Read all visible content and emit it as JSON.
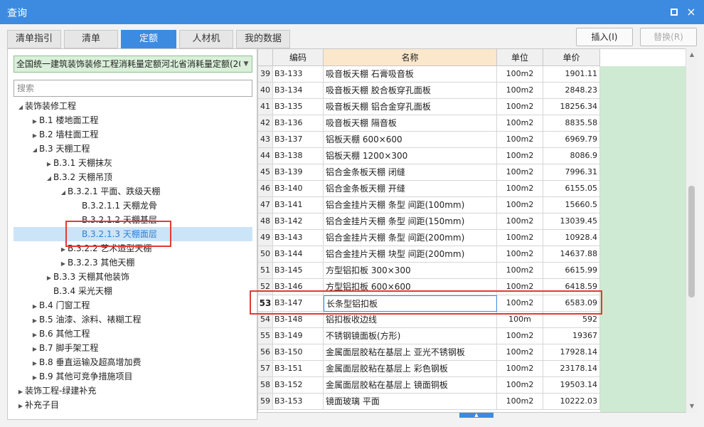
{
  "window": {
    "title": "查询",
    "maximize_label": "",
    "close_label": "×"
  },
  "tabs": [
    {
      "label": "清单指引",
      "active": false
    },
    {
      "label": "清单",
      "active": false
    },
    {
      "label": "定额",
      "active": true
    },
    {
      "label": "人材机",
      "active": false
    },
    {
      "label": "我的数据",
      "active": false
    }
  ],
  "actions": {
    "insert": "插入(I)",
    "replace": "替换(R)"
  },
  "library": {
    "selected": "全国统一建筑装饰装修工程消耗量定额河北省消耗量定额(20"
  },
  "search": {
    "placeholder": "搜索"
  },
  "tree": [
    {
      "label": "装饰装修工程",
      "expanded": true
    },
    {
      "label": "B.1 楼地面工程",
      "expanded": false
    },
    {
      "label": "B.2 墙柱面工程",
      "expanded": false
    },
    {
      "label": "B.3 天棚工程",
      "expanded": true
    },
    {
      "label": "B.3.1 天棚抹灰",
      "expanded": false
    },
    {
      "label": "B.3.2 天棚吊顶",
      "expanded": true
    },
    {
      "label": "B.3.2.1 平面、跌级天棚",
      "expanded": true
    },
    {
      "label": "B.3.2.1.1 天棚龙骨",
      "expanded": null
    },
    {
      "label": "B.3.2.1.2 天棚基层",
      "expanded": null
    },
    {
      "label": "B.3.2.1.3 天棚面层",
      "expanded": null,
      "selected": true
    },
    {
      "label": "B.3.2.2 艺术造型天棚",
      "expanded": false
    },
    {
      "label": "B.3.2.3 其他天棚",
      "expanded": false
    },
    {
      "label": "B.3.3 天棚其他装饰",
      "expanded": false
    },
    {
      "label": "B.3.4 采光天棚",
      "expanded": null
    },
    {
      "label": "B.4 门窗工程",
      "expanded": false
    },
    {
      "label": "B.5 油漆、涂料、裱糊工程",
      "expanded": false
    },
    {
      "label": "B.6 其他工程",
      "expanded": false
    },
    {
      "label": "B.7 脚手架工程",
      "expanded": false
    },
    {
      "label": "B.8 垂直运输及超高增加费",
      "expanded": false
    },
    {
      "label": "B.9 其他可竞争措施项目",
      "expanded": false
    },
    {
      "label": "装饰工程-绿建补充",
      "expanded": false
    },
    {
      "label": "补充子目",
      "expanded": false
    }
  ],
  "grid": {
    "headers": {
      "index": "",
      "code": "编码",
      "name": "名称",
      "unit": "单位",
      "price": "单价"
    },
    "rows": [
      {
        "index": "39",
        "code": "B3-133",
        "name": "吸音板天棚 石膏吸音板",
        "unit": "100m2",
        "price": "1901.11"
      },
      {
        "index": "40",
        "code": "B3-134",
        "name": "吸音板天棚 胶合板穿孔面板",
        "unit": "100m2",
        "price": "2848.23"
      },
      {
        "index": "41",
        "code": "B3-135",
        "name": "吸音板天棚 铝合金穿孔面板",
        "unit": "100m2",
        "price": "18256.34"
      },
      {
        "index": "42",
        "code": "B3-136",
        "name": "吸音板天棚 隔音板",
        "unit": "100m2",
        "price": "8835.58"
      },
      {
        "index": "43",
        "code": "B3-137",
        "name": "铝板天棚 600×600",
        "unit": "100m2",
        "price": "6969.79"
      },
      {
        "index": "44",
        "code": "B3-138",
        "name": "铝板天棚 1200×300",
        "unit": "100m2",
        "price": "8086.9"
      },
      {
        "index": "45",
        "code": "B3-139",
        "name": "铝合金条板天棚 闭缝",
        "unit": "100m2",
        "price": "7996.31"
      },
      {
        "index": "46",
        "code": "B3-140",
        "name": "铝合金条板天棚 开缝",
        "unit": "100m2",
        "price": "6155.05"
      },
      {
        "index": "47",
        "code": "B3-141",
        "name": "铝合金挂片天棚 条型 间距(100mm)",
        "unit": "100m2",
        "price": "15660.5"
      },
      {
        "index": "48",
        "code": "B3-142",
        "name": "铝合金挂片天棚 条型 间距(150mm)",
        "unit": "100m2",
        "price": "13039.45"
      },
      {
        "index": "49",
        "code": "B3-143",
        "name": "铝合金挂片天棚 条型 间距(200mm)",
        "unit": "100m2",
        "price": "10928.4"
      },
      {
        "index": "50",
        "code": "B3-144",
        "name": "铝合金挂片天棚 块型 间距(200mm)",
        "unit": "100m2",
        "price": "14637.88"
      },
      {
        "index": "51",
        "code": "B3-145",
        "name": "方型铝扣板 300×300",
        "unit": "100m2",
        "price": "6615.99"
      },
      {
        "index": "52",
        "code": "B3-146",
        "name": "方型铝扣板 600×600",
        "unit": "100m2",
        "price": "6418.59"
      },
      {
        "index": "53",
        "code": "B3-147",
        "name": "长条型铝扣板",
        "unit": "100m2",
        "price": "6583.09",
        "active": true
      },
      {
        "index": "54",
        "code": "B3-148",
        "name": "铝扣板收边线",
        "unit": "100m",
        "price": "592"
      },
      {
        "index": "55",
        "code": "B3-149",
        "name": "不锈钢镜面板(方形)",
        "unit": "100m2",
        "price": "19367"
      },
      {
        "index": "56",
        "code": "B3-150",
        "name": "金属面层胶粘在基层上 亚光不锈钢板",
        "unit": "100m2",
        "price": "17928.14"
      },
      {
        "index": "57",
        "code": "B3-151",
        "name": "金属面层胶粘在基层上 彩色钢板",
        "unit": "100m2",
        "price": "23178.14"
      },
      {
        "index": "58",
        "code": "B3-152",
        "name": "金属面层胶粘在基层上 镜面铜板",
        "unit": "100m2",
        "price": "19503.14"
      },
      {
        "index": "59",
        "code": "B3-153",
        "name": "镜面玻璃 平面",
        "unit": "100m2",
        "price": "10222.03"
      }
    ]
  },
  "scroll": {
    "position": 0.55,
    "visible_fraction": 0.33
  },
  "colors": {
    "accent": "#3c8be0",
    "highlight": "#e53935",
    "green": "#cfead2",
    "selection": "#cce4f7"
  }
}
